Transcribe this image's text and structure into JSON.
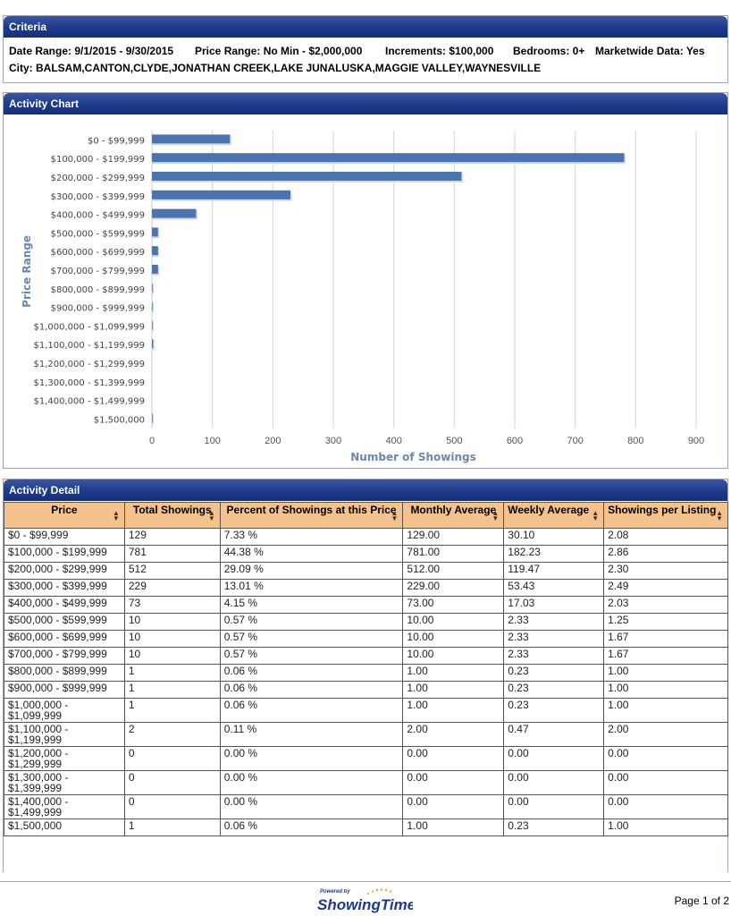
{
  "criteria": {
    "title": "Criteria",
    "date_range": "Date Range: 9/1/2015 - 9/30/2015",
    "price_range": "Price Range: No Min - $2,000,000",
    "increments": "Increments: $100,000",
    "bedrooms": "Bedrooms: 0+",
    "marketwide": "Marketwide Data: Yes",
    "city": "City:  BALSAM,CANTON,CLYDE,JONATHAN CREEK,LAKE JUNALUSKA,MAGGIE VALLEY,WAYNESVILLE"
  },
  "chart_panel": {
    "title": "Activity Chart"
  },
  "chart_data": {
    "type": "bar",
    "orientation": "horizontal",
    "categories": [
      "$0 - $99,999",
      "$100,000 - $199,999",
      "$200,000 - $299,999",
      "$300,000 - $399,999",
      "$400,000 - $499,999",
      "$500,000 - $599,999",
      "$600,000 - $699,999",
      "$700,000 - $799,999",
      "$800,000 - $899,999",
      "$900,000 - $999,999",
      "$1,000,000 - $1,099,999",
      "$1,100,000 - $1,199,999",
      "$1,200,000 - $1,299,999",
      "$1,300,000 - $1,399,999",
      "$1,400,000 - $1,499,999",
      "$1,500,000"
    ],
    "values": [
      129,
      781,
      512,
      229,
      73,
      10,
      10,
      10,
      1,
      1,
      1,
      2,
      0,
      0,
      0,
      1
    ],
    "xlabel": "Number of Showings",
    "ylabel": "Price Range",
    "xlim": [
      0,
      900
    ],
    "xticks": [
      0,
      100,
      200,
      300,
      400,
      500,
      600,
      700,
      800,
      900
    ],
    "grid": true,
    "bar_color": "#4a73b0"
  },
  "detail": {
    "title": "Activity Detail",
    "headers": [
      "Price",
      "Total Showings",
      "Percent of Showings at this Price",
      "Monthly Average",
      "Weekly Average",
      "Showings per Listing"
    ],
    "rows": [
      [
        "$0 - $99,999",
        "129",
        "7.33 %",
        "129.00",
        "30.10",
        "2.08"
      ],
      [
        "$100,000 - $199,999",
        "781",
        "44.38 %",
        "781.00",
        "182.23",
        "2.86"
      ],
      [
        "$200,000 - $299,999",
        "512",
        "29.09 %",
        "512.00",
        "119.47",
        "2.30"
      ],
      [
        "$300,000 - $399,999",
        "229",
        "13.01 %",
        "229.00",
        "53.43",
        "2.49"
      ],
      [
        "$400,000 - $499,999",
        "73",
        "4.15 %",
        "73.00",
        "17.03",
        "2.03"
      ],
      [
        "$500,000 - $599,999",
        "10",
        "0.57 %",
        "10.00",
        "2.33",
        "1.25"
      ],
      [
        "$600,000 - $699,999",
        "10",
        "0.57 %",
        "10.00",
        "2.33",
        "1.67"
      ],
      [
        "$700,000 - $799,999",
        "10",
        "0.57 %",
        "10.00",
        "2.33",
        "1.67"
      ],
      [
        "$800,000 - $899,999",
        "1",
        "0.06 %",
        "1.00",
        "0.23",
        "1.00"
      ],
      [
        "$900,000 - $999,999",
        "1",
        "0.06 %",
        "1.00",
        "0.23",
        "1.00"
      ],
      [
        "$1,000,000 - $1,099,999",
        "1",
        "0.06 %",
        "1.00",
        "0.23",
        "1.00"
      ],
      [
        "$1,100,000 - $1,199,999",
        "2",
        "0.11 %",
        "2.00",
        "0.47",
        "2.00"
      ],
      [
        "$1,200,000 - $1,299,999",
        "0",
        "0.00 %",
        "0.00",
        "0.00",
        "0.00"
      ],
      [
        "$1,300,000 - $1,399,999",
        "0",
        "0.00 %",
        "0.00",
        "0.00",
        "0.00"
      ],
      [
        "$1,400,000 - $1,499,999",
        "0",
        "0.00 %",
        "0.00",
        "0.00",
        "0.00"
      ],
      [
        "$1,500,000",
        "1",
        "0.06 %",
        "1.00",
        "0.23",
        "1.00"
      ]
    ]
  },
  "footer": {
    "powered_by": "Powered by",
    "brand": "ShowingTime",
    "page": "Page 1 of 2"
  }
}
